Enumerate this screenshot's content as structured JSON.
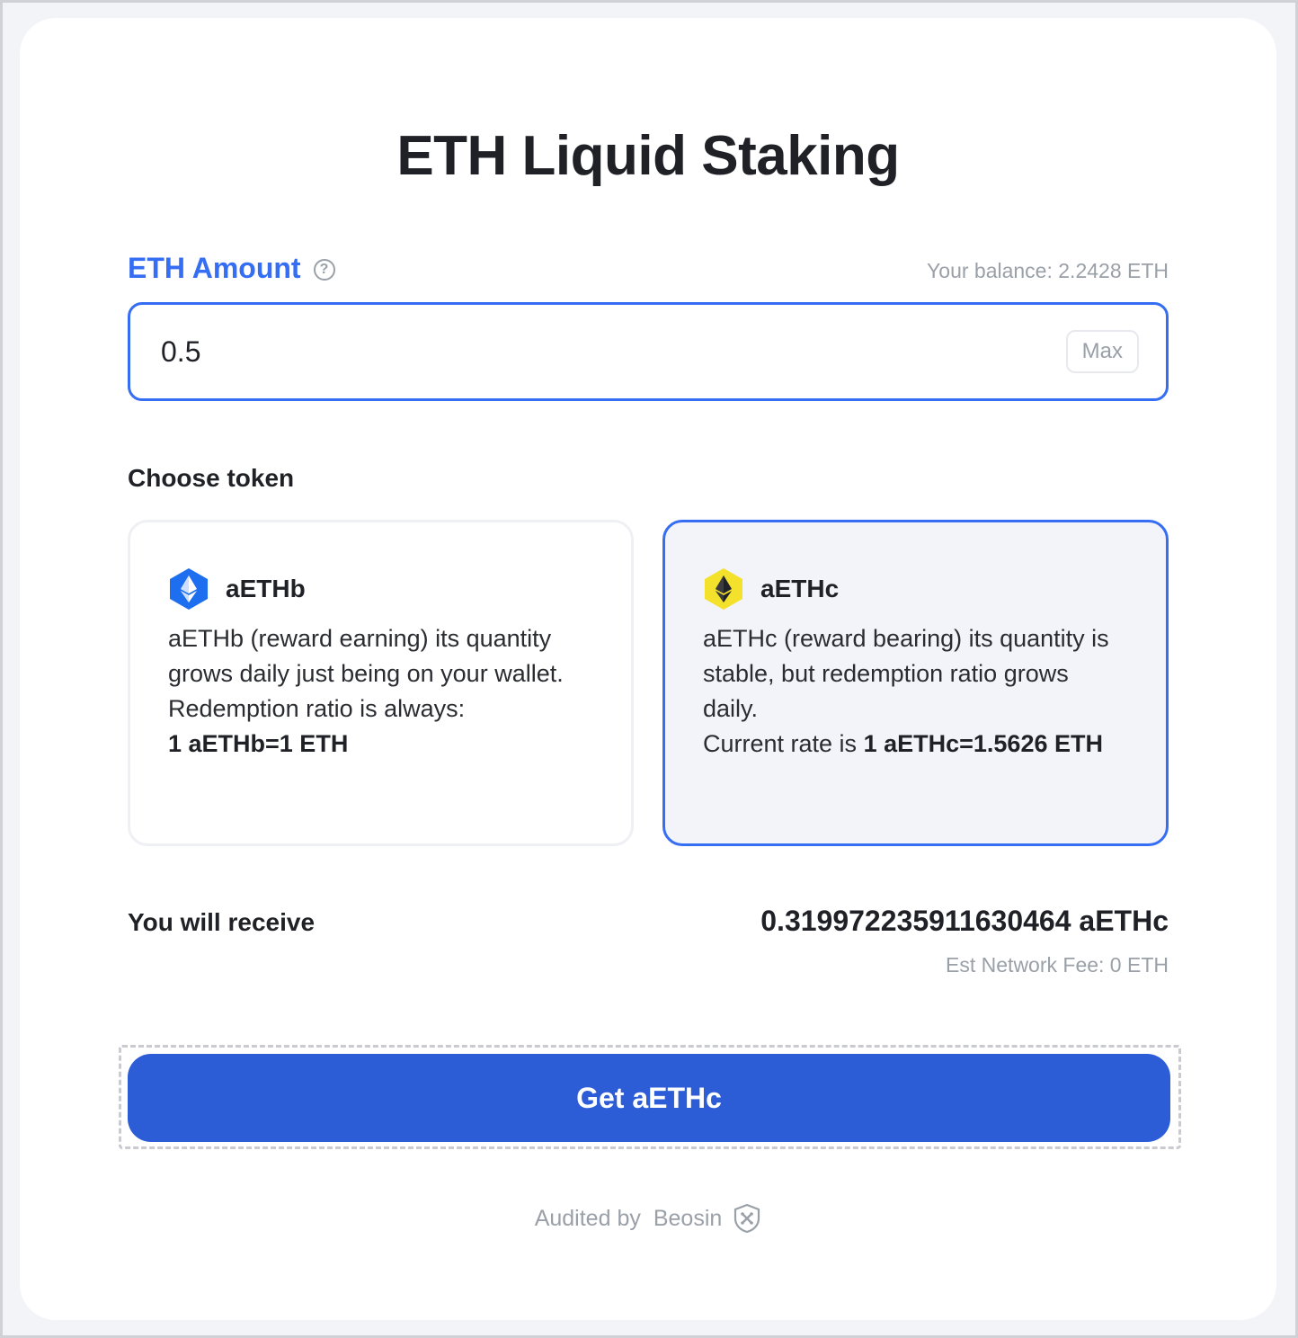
{
  "page": {
    "title": "ETH Liquid Staking"
  },
  "amount": {
    "label": "ETH Amount",
    "help_icon": "question-circle-icon",
    "balance_text": "Your balance: 2.2428 ETH",
    "value": "0.5",
    "max_label": "Max"
  },
  "choose_token": {
    "heading": "Choose token",
    "tokens": [
      {
        "name": "aETHb",
        "icon": "ethereum-hexagon-blue-icon",
        "description": "aETHb (reward earning) its quantity grows daily just being on your wallet. Redemption ratio is always:",
        "rate": "1 aETHb=1 ETH",
        "selected": false
      },
      {
        "name": "aETHc",
        "icon": "ethereum-hexagon-yellow-icon",
        "description": "aETHc (reward bearing) its quantity is stable, but redemption ratio grows daily.",
        "rate_prefix": "Current rate is",
        "rate": "1 aETHc=1.5626 ETH",
        "selected": true
      }
    ]
  },
  "receive": {
    "label": "You will receive",
    "value": "0.319972235911630464 aETHc",
    "fee": "Est Network Fee: 0 ETH"
  },
  "action": {
    "button_label": "Get aETHc"
  },
  "footer": {
    "audited_by": "Audited by",
    "auditor": "Beosin",
    "auditor_icon": "beosin-shield-icon"
  },
  "colors": {
    "accent": "#356df3",
    "button": "#2c5cd6",
    "muted": "#9aa0a8",
    "token_b": "#1e6ff0",
    "token_c": "#f4e12b"
  }
}
